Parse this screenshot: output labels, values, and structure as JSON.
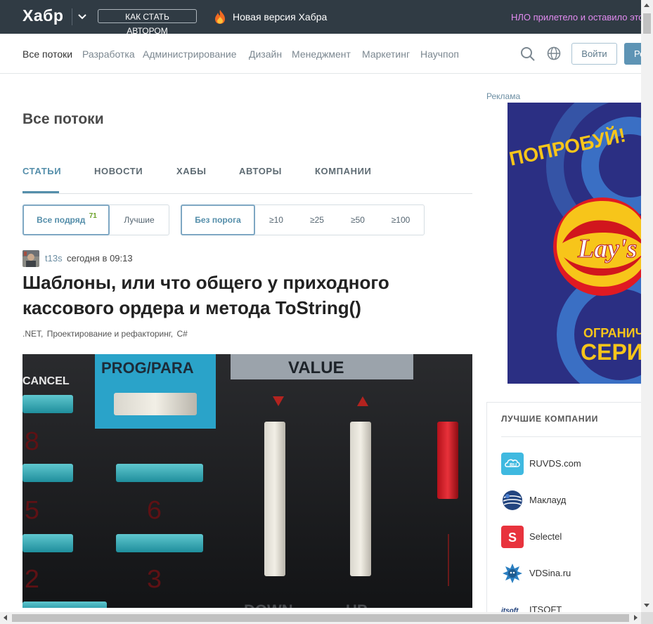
{
  "topbar": {
    "logo": "Хабр",
    "become_author": "КАК СТАТЬ АВТОРОМ",
    "new_version": "Новая версия Хабра",
    "nlo": "НЛО прилетело и оставило это"
  },
  "nav": {
    "items": [
      "Все потоки",
      "Разработка",
      "Администрирование",
      "Дизайн",
      "Менеджмент",
      "Маркетинг",
      "Научпоп"
    ],
    "login": "Войти",
    "register": "Регистрация"
  },
  "main": {
    "title": "Все потоки",
    "tabs": [
      "СТАТЬИ",
      "НОВОСТИ",
      "ХАБЫ",
      "АВТОРЫ",
      "КОМПАНИИ"
    ],
    "filters_sort": {
      "all": "Все подряд",
      "all_count": "71",
      "best": "Лучшие"
    },
    "filters_threshold": [
      "Без порога",
      "≥10",
      "≥25",
      "≥50",
      "≥100"
    ]
  },
  "post": {
    "author": "t13s",
    "time": "сегодня в 09:13",
    "title": "Шаблоны, или что общего у приходного кассового ордера и метода ToString()",
    "hubs": [
      ".NET,",
      "Проектирование и рефакторинг,",
      "C#"
    ],
    "image_labels": {
      "cancel": "CANCEL",
      "prog_para": "PROG/PARA",
      "value": "VALUE",
      "down": "DOWN",
      "up": "UP"
    }
  },
  "sidebar": {
    "ad_label": "Реклама",
    "ad": {
      "try": "ПОПРОБУЙ!",
      "brand": "Lay's",
      "limited": "ОГРАНИЧЕН",
      "series": "СЕРИ"
    },
    "companies_title": "ЛУЧШИЕ КОМПАНИИ",
    "companies": [
      {
        "name": "RUVDS.com",
        "logo_text": "RU"
      },
      {
        "name": "Маклауд",
        "logo_text": ""
      },
      {
        "name": "Selectel",
        "logo_text": "S"
      },
      {
        "name": "VDSina.ru",
        "logo_text": ""
      },
      {
        "name": "ITSOFT",
        "logo_text": "itsoft"
      }
    ]
  },
  "colors": {
    "topbar": "#303b44",
    "accent": "#548eaa",
    "nlo": "#e28bf0",
    "ad_bg": "#2b2f83",
    "ad_yellow": "#f7c51a"
  }
}
